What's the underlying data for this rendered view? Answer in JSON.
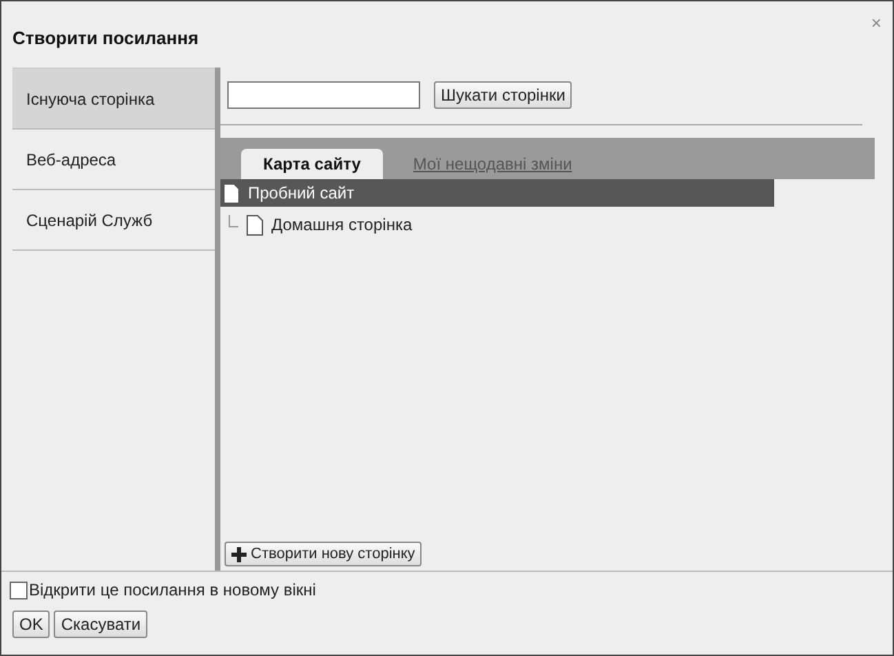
{
  "dialog": {
    "title": "Створити посилання",
    "close": "×"
  },
  "sidebar": {
    "items": [
      {
        "label": "Існуюча сторінка",
        "selected": true
      },
      {
        "label": "Веб-адреса",
        "selected": false
      },
      {
        "label": "Сценарій Служб",
        "selected": false
      }
    ]
  },
  "search": {
    "button": "Шукати сторінки"
  },
  "tabs": [
    {
      "label": "Карта сайту",
      "selected": true
    },
    {
      "label": "Мої нещодавні зміни",
      "selected": false
    }
  ],
  "tree": [
    {
      "label": "Пробний сайт",
      "selected": true,
      "children": [
        {
          "label": "Домашня сторінка",
          "selected": false
        }
      ]
    }
  ],
  "create_button": "Створити нову сторінку",
  "new_window": {
    "label": "Відкрити це посилання в новому вікні",
    "checked": false
  },
  "buttons": [
    "OK",
    "Скасувати"
  ]
}
